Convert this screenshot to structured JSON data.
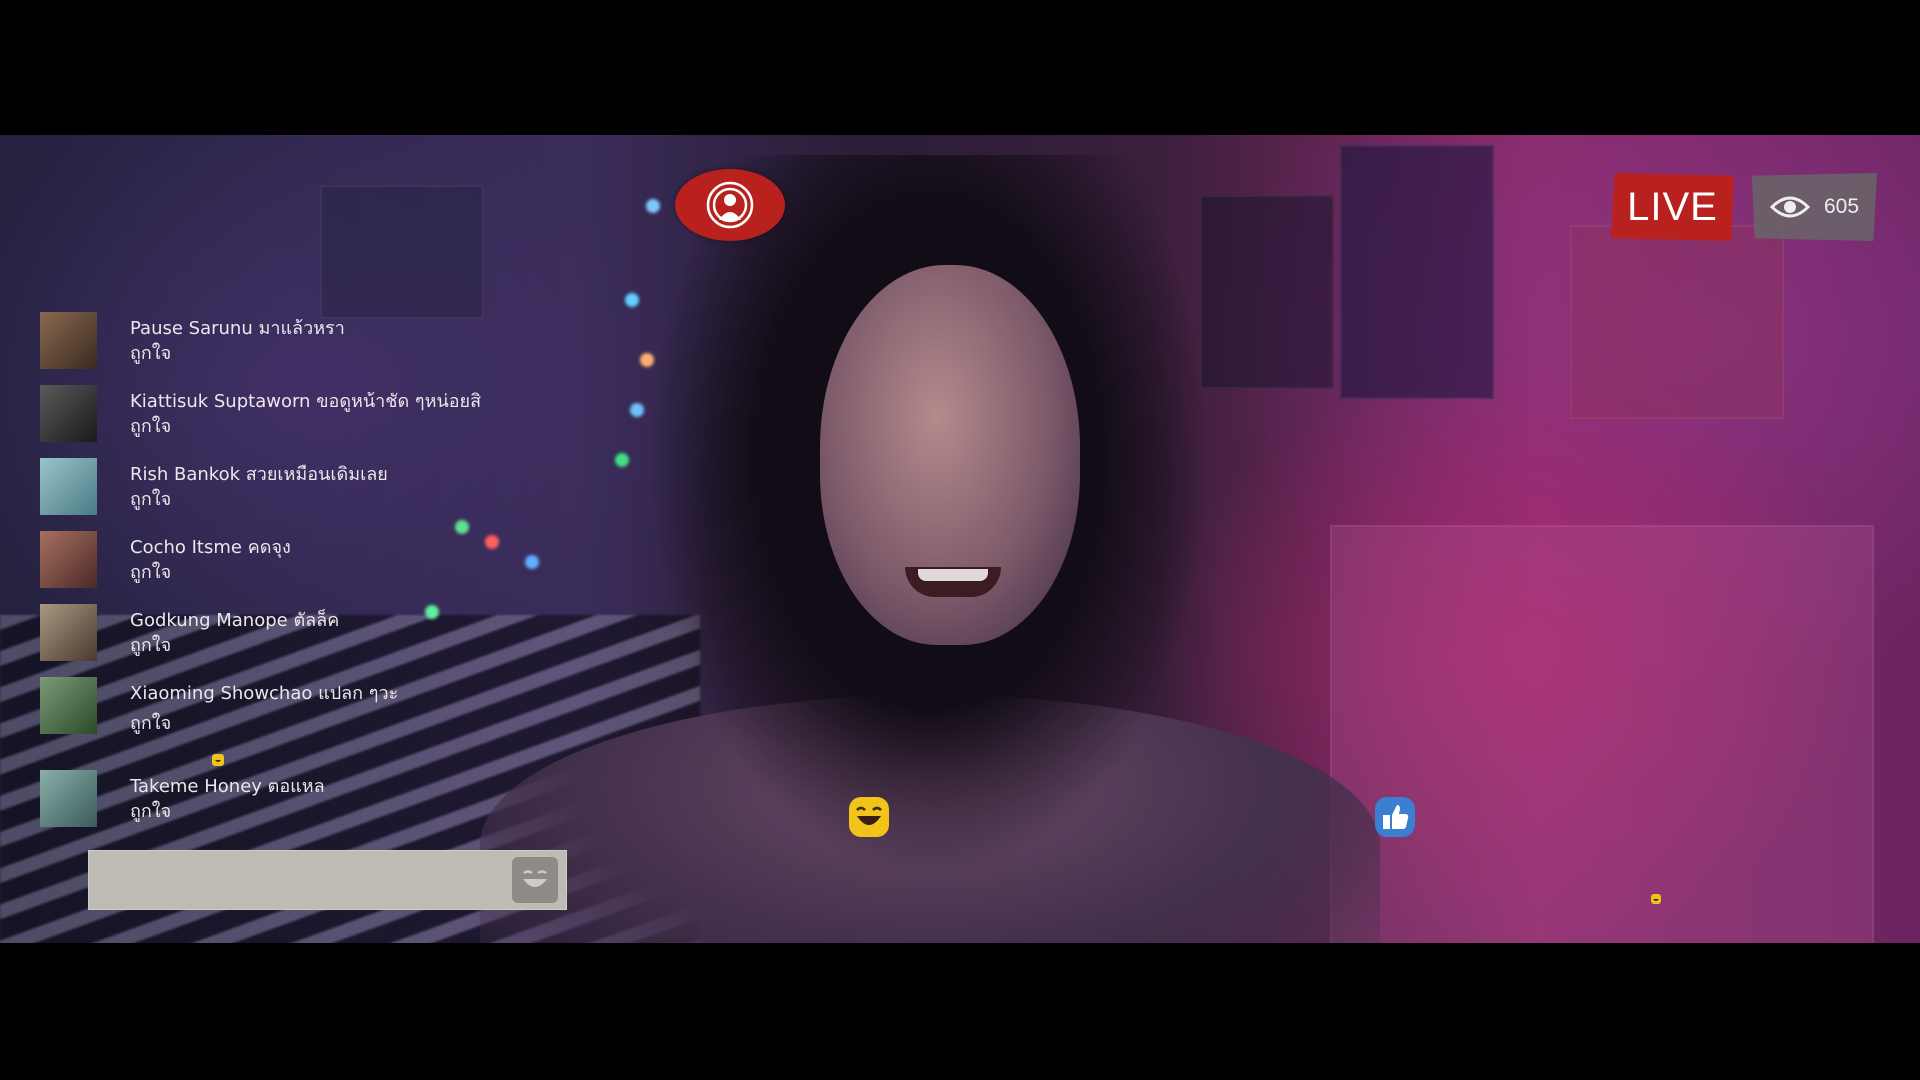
{
  "stream": {
    "live_label": "LIVE",
    "viewer_count": "605"
  },
  "comments": [
    {
      "name": "Pause Sarunu",
      "message": "มาแล้วหรา",
      "reaction": "ถูกใจ",
      "avatar_color": "#6b5040"
    },
    {
      "name": "Kiattisuk Suptaworn",
      "message": "ขอดูหน้าชัด ๆหน่อยสิ",
      "reaction": "ถูกใจ",
      "avatar_color": "#3a3a3a"
    },
    {
      "name": "Rish Bankok",
      "message": "สวยเหมือนเดิมเลย",
      "reaction": "ถูกใจ",
      "avatar_color": "#6a9aa4"
    },
    {
      "name": "Cocho Itsme",
      "message": "คดจุง",
      "reaction": "ถูกใจ",
      "avatar_color": "#7a5048"
    },
    {
      "name": "Godkung Manope",
      "message": "ตัลล็ค",
      "reaction": "ถูกใจ",
      "avatar_color": "#7a6a5a"
    },
    {
      "name": "Xiaoming Showchao",
      "message": "แปลก ๆวะ",
      "reaction": "ถูกใจ",
      "avatar_color": "#4a6a48"
    },
    {
      "name": "Takeme Honey",
      "message": "ตอแหล",
      "reaction": "ถูกใจ",
      "avatar_color": "#5a7a7a"
    }
  ],
  "icons": {
    "broadcast": "broadcast-icon",
    "viewers": "eye-icon",
    "laugh_reaction": "laugh-emoji-icon",
    "like_reaction": "thumbs-up-icon",
    "input_emoji": "emoji-icon"
  },
  "colors": {
    "live_red": "#b8211e",
    "viewer_gray": "#69646a",
    "like_blue": "#3b7fd0",
    "emoji_yellow": "#f2c318"
  }
}
